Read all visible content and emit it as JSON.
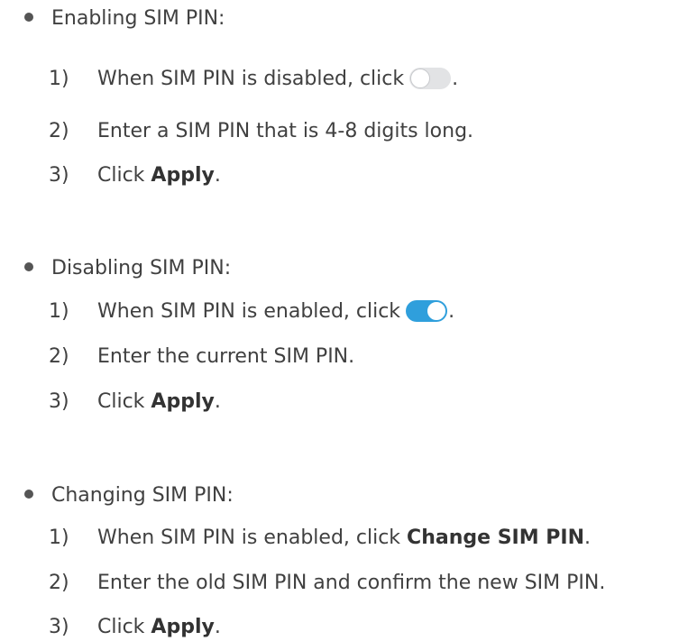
{
  "sections": [
    {
      "heading": "Enabling SIM PIN:",
      "steps": [
        {
          "num": "1)",
          "text": "When SIM PIN is disabled, click",
          "suffix": "."
        },
        {
          "num": "2)",
          "text": "Enter a SIM PIN that is 4-8 digits long."
        },
        {
          "num": "3)",
          "text": "Click ",
          "bold": "Apply",
          "suffix": "."
        }
      ],
      "toggle_state": "off"
    },
    {
      "heading": "Disabling SIM PIN:",
      "steps": [
        {
          "num": "1)",
          "text": "When SIM PIN is enabled, click",
          "suffix": "."
        },
        {
          "num": "2)",
          "text": "Enter the current SIM PIN."
        },
        {
          "num": "3)",
          "text": "Click ",
          "bold": "Apply",
          "suffix": "."
        }
      ],
      "toggle_state": "on"
    },
    {
      "heading": "Changing SIM PIN:",
      "steps": [
        {
          "num": "1)",
          "text": "When SIM PIN is enabled, click ",
          "bold": "Change SIM PIN",
          "suffix": "."
        },
        {
          "num": "2)",
          "text": "Enter the old SIM PIN and confirm the new SIM PIN."
        },
        {
          "num": "3)",
          "text": "Click ",
          "bold": "Apply",
          "suffix": "."
        }
      ]
    }
  ],
  "colors": {
    "text": "#404040",
    "toggle_on": "#2f9fdc",
    "toggle_off": "#e2e3e5"
  }
}
